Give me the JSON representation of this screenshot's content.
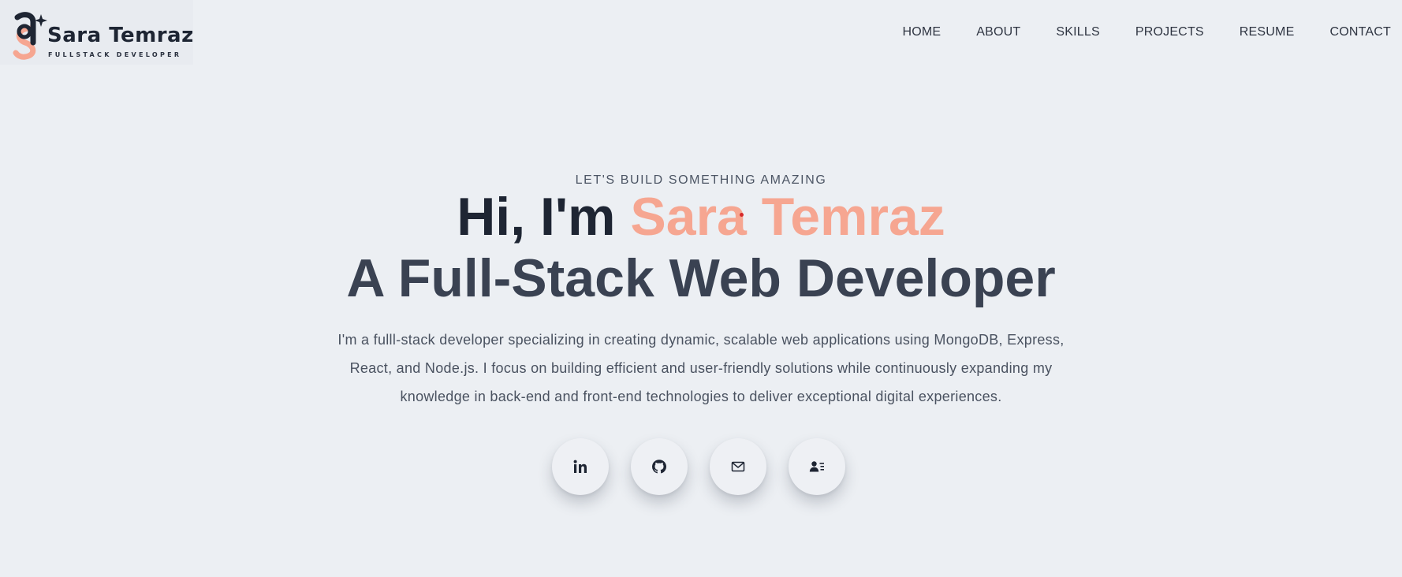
{
  "logo": {
    "name": "Sara Temraz",
    "tagline": "FULLSTACK DEVELOPER",
    "colors": {
      "dark": "#1e2533",
      "accent": "#f6a691"
    }
  },
  "nav": {
    "items": [
      {
        "label": "HOME"
      },
      {
        "label": "ABOUT"
      },
      {
        "label": "SKILLS"
      },
      {
        "label": "PROJECTS"
      },
      {
        "label": "RESUME"
      },
      {
        "label": "CONTACT"
      }
    ]
  },
  "hero": {
    "eyebrow": "LET'S BUILD SOMETHING AMAZING",
    "greeting": "Hi, I'm ",
    "name": "Sara Temraz",
    "role": "A Full-Stack Web Developer",
    "description": "I'm a fulll-stack developer specializing in creating dynamic, scalable web applications using MongoDB, Express, React, and Node.js. I focus on building efficient and user-friendly solutions while continuously expanding my knowledge in back-end and front-end technologies to deliver exceptional digital experiences."
  },
  "socials": [
    {
      "icon": "linkedin-icon"
    },
    {
      "icon": "github-icon"
    },
    {
      "icon": "mail-icon"
    },
    {
      "icon": "contact-card-icon"
    }
  ],
  "colors": {
    "background": "#eceff3",
    "accent": "#f6a691",
    "heading": "#1e2533",
    "text": "#4a5260"
  }
}
